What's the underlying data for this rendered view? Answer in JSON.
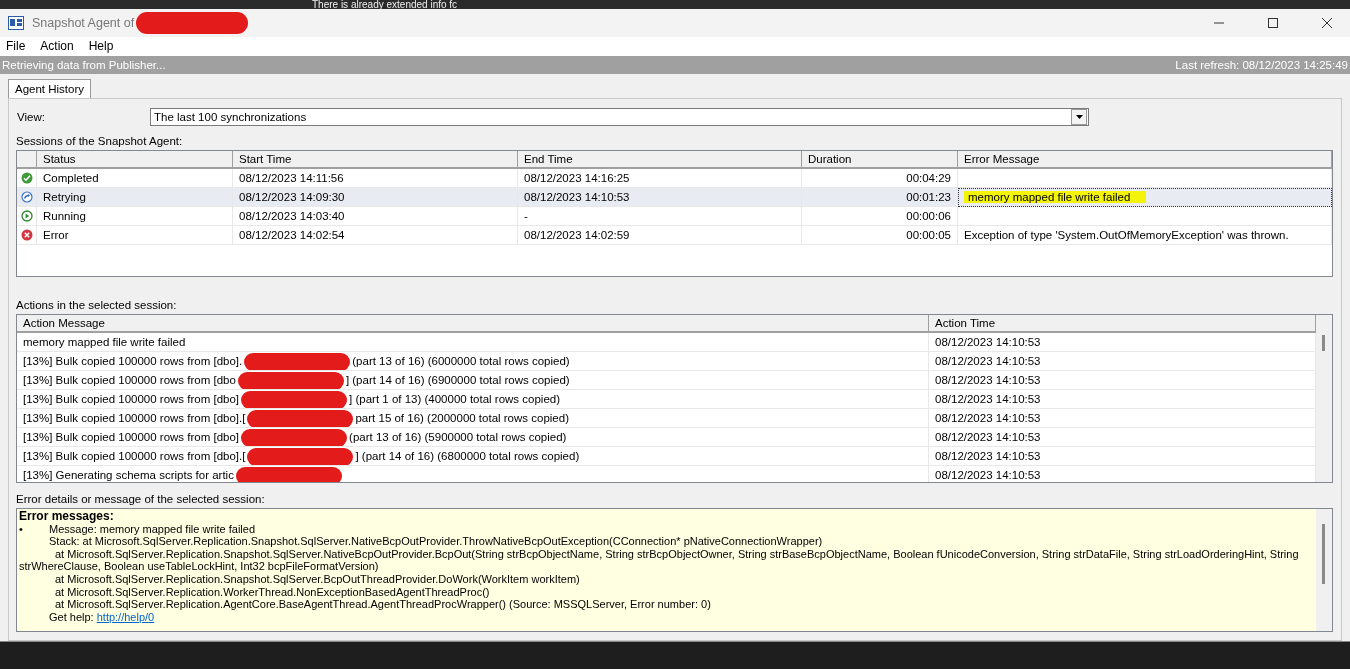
{
  "host_toolbar": {
    "text": "There is already extended info fc"
  },
  "window": {
    "title": "Snapshot Agent of"
  },
  "menu": [
    "File",
    "Action",
    "Help"
  ],
  "status_bar": {
    "message": "Retrieving data from Publisher...",
    "last_refresh": "Last refresh: 08/12/2023 14:25:49"
  },
  "tabs": [
    {
      "label": "Agent History",
      "selected": true
    }
  ],
  "view": {
    "label": "View:",
    "value": "The last 100 synchronizations"
  },
  "sessions": {
    "title": "Sessions of the Snapshot Agent:",
    "columns": [
      "Status",
      "Start Time",
      "End Time",
      "Duration",
      "Error Message"
    ],
    "rows": [
      {
        "kind": "completed",
        "status": "Completed",
        "start": "08/12/2023 14:11:56",
        "end": "08/12/2023 14:16:25",
        "duration": "00:04:29",
        "error": "",
        "selected": false,
        "highlighted": false
      },
      {
        "kind": "retrying",
        "status": "Retrying",
        "start": "08/12/2023 14:09:30",
        "end": "08/12/2023 14:10:53",
        "duration": "00:01:23",
        "error": "memory mapped file write failed",
        "selected": true,
        "highlighted": true
      },
      {
        "kind": "running",
        "status": "Running",
        "start": "08/12/2023 14:03:40",
        "end": "-",
        "duration": "00:00:06",
        "error": "",
        "selected": false,
        "highlighted": false
      },
      {
        "kind": "error",
        "status": "Error",
        "start": "08/12/2023 14:02:54",
        "end": "08/12/2023 14:02:59",
        "duration": "00:00:05",
        "error": "Exception of type 'System.OutOfMemoryException' was thrown.",
        "selected": false,
        "highlighted": false
      }
    ]
  },
  "actions": {
    "title": "Actions in the selected session:",
    "columns": [
      "Action Message",
      "Action Time"
    ],
    "rows": [
      {
        "message": "memory mapped file write failed",
        "redacted": false,
        "suffix": "",
        "time": "08/12/2023 14:10:53"
      },
      {
        "message": "[13%] Bulk copied 100000 rows from [dbo].",
        "redacted": true,
        "suffix": "(part 13 of 16) (6000000 total rows copied)",
        "time": "08/12/2023 14:10:53"
      },
      {
        "message": "[13%] Bulk copied 100000 rows from [dbo",
        "redacted": true,
        "suffix": "] (part 14 of 16) (6900000 total rows copied)",
        "time": "08/12/2023 14:10:53"
      },
      {
        "message": "[13%] Bulk copied 100000 rows from [dbo]",
        "redacted": true,
        "suffix": "] (part 1 of 13) (400000 total rows copied)",
        "time": "08/12/2023 14:10:53"
      },
      {
        "message": "[13%] Bulk copied 100000 rows from [dbo].[",
        "redacted": true,
        "suffix": "part 15 of 16) (2000000 total rows copied)",
        "time": "08/12/2023 14:10:53"
      },
      {
        "message": "[13%] Bulk copied 100000 rows from [dbo]",
        "redacted": true,
        "suffix": "(part 13 of 16) (5900000 total rows copied)",
        "time": "08/12/2023 14:10:53"
      },
      {
        "message": "[13%] Bulk copied 100000 rows from [dbo].[",
        "redacted": true,
        "suffix": "] (part 14 of 16) (6800000 total rows copied)",
        "time": "08/12/2023 14:10:53"
      },
      {
        "message": "[13%] Generating schema scripts for artic",
        "redacted": true,
        "suffix": "",
        "time": "08/12/2023 14:10:53"
      }
    ]
  },
  "details": {
    "title": "Error details or message of the selected session:",
    "heading": "Error messages:",
    "bullet": "•",
    "lines": [
      {
        "kind": "message",
        "text": "Message: memory mapped file write failed"
      },
      {
        "kind": "stack",
        "text": "Stack:     at Microsoft.SqlServer.Replication.Snapshot.SqlServer.NativeBcpOutProvider.ThrowNativeBcpOutException(CConnection* pNativeConnectionWrapper)"
      },
      {
        "kind": "frame",
        "text": "at Microsoft.SqlServer.Replication.Snapshot.SqlServer.NativeBcpOutProvider.BcpOut(String strBcpObjectName, String strBcpObjectOwner, String strBaseBcpObjectName, Boolean fUnicodeConversion, String strDataFile, String strLoadOrderingHint, String strWhereClause, Boolean useTableLockHint, Int32 bcpFileFormatVersion)"
      },
      {
        "kind": "frame",
        "text": "at Microsoft.SqlServer.Replication.Snapshot.SqlServer.BcpOutThreadProvider.DoWork(WorkItem workItem)"
      },
      {
        "kind": "frame",
        "text": "at Microsoft.SqlServer.Replication.WorkerThread.NonExceptionBasedAgentThreadProc()"
      },
      {
        "kind": "frame",
        "text": "at Microsoft.SqlServer.Replication.AgentCore.BaseAgentThread.AgentThreadProcWrapper() (Source: MSSQLServer, Error number: 0)"
      }
    ],
    "help_label": "Get help:",
    "help_link": "http://help/0"
  }
}
